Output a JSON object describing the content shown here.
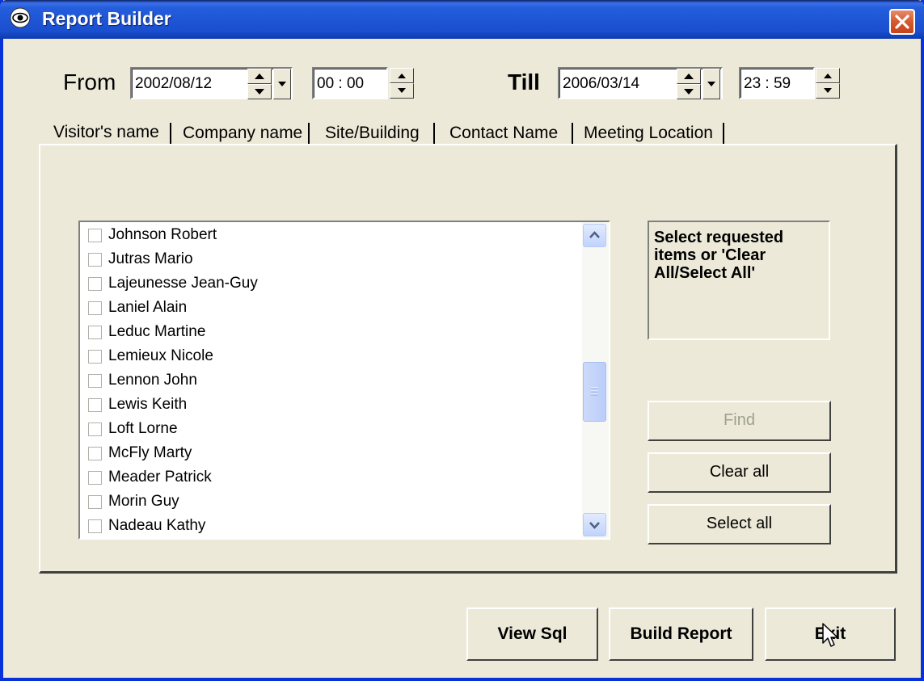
{
  "window": {
    "title": "Report Builder"
  },
  "date_range": {
    "from_label": "From",
    "from_date": "2002/08/12",
    "from_time": "00 : 00",
    "till_label": "Till",
    "till_date": "2006/03/14",
    "till_time": "23 : 59"
  },
  "tabs": [
    {
      "label": "Visitor's name"
    },
    {
      "label": "Company name"
    },
    {
      "label": "Site/Building"
    },
    {
      "label": "Contact Name"
    },
    {
      "label": "Meeting Location"
    }
  ],
  "list": {
    "items": [
      "Johnson  Robert",
      "Jutras  Mario",
      "Lajeunesse  Jean-Guy",
      "Laniel  Alain",
      "Leduc  Martine",
      "Lemieux  Nicole",
      "Lennon  John",
      "Lewis  Keith",
      "Loft  Lorne",
      "McFly  Marty",
      "Meader  Patrick",
      "Morin  Guy",
      "Nadeau  Kathy"
    ]
  },
  "hint_text": "Select requested items or 'Clear All/Select All'",
  "side_buttons": {
    "find": "Find",
    "clear_all": "Clear all",
    "select_all": "Select all"
  },
  "bottom_buttons": {
    "view_sql": "View Sql",
    "build_report": "Build Report",
    "exit": "Exit"
  },
  "colors": {
    "titlebar": "#245EDC",
    "window_bg": "#ECE9D8",
    "close": "#D35A2F"
  }
}
